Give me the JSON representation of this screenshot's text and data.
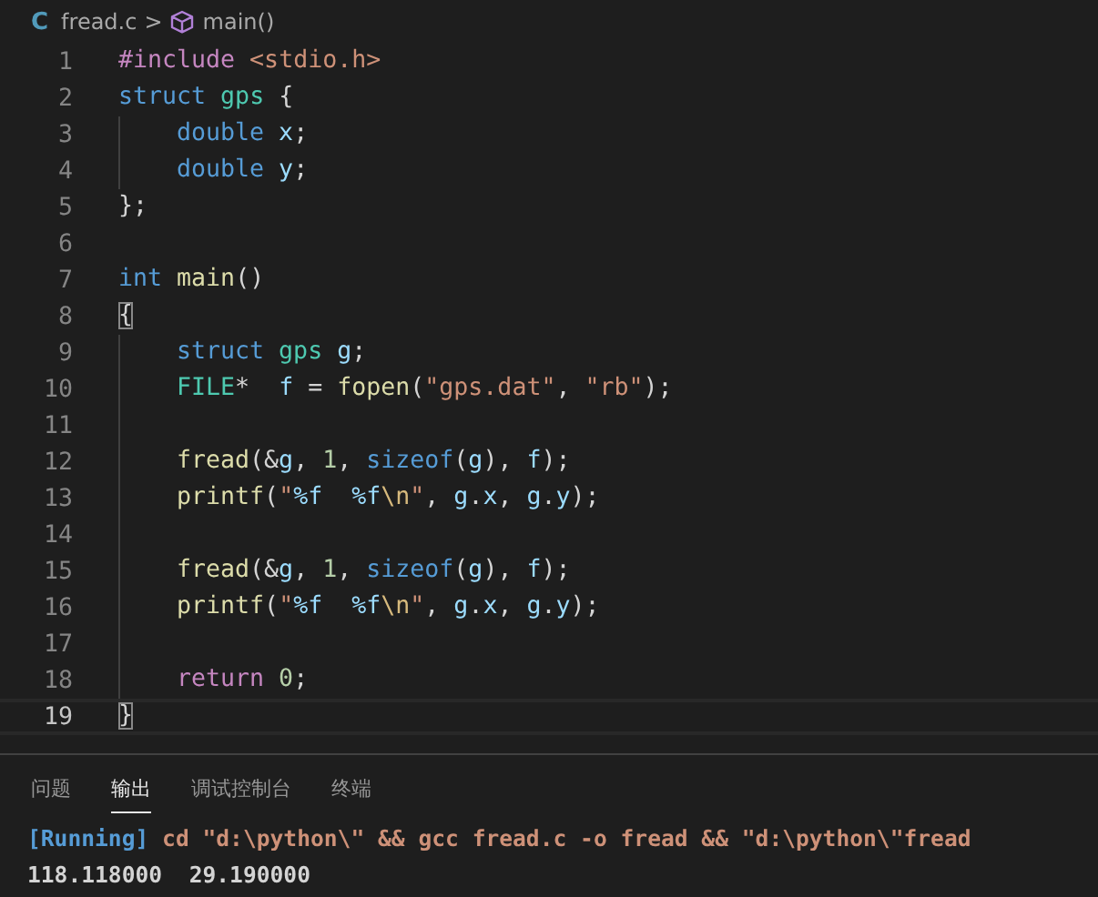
{
  "breadcrumb": {
    "lang_icon": "C",
    "file": "fread.c",
    "separator": ">",
    "symbol": "main()"
  },
  "lines": [
    {
      "number": "1",
      "current": false,
      "indent": false,
      "tokens": [
        {
          "kind": "control",
          "text": "#include"
        },
        {
          "kind": "string",
          "text": " <stdio.h>"
        }
      ]
    },
    {
      "number": "2",
      "current": false,
      "indent": false,
      "tokens": [
        {
          "kind": "keyword",
          "text": "struct"
        },
        {
          "kind": "type",
          "text": " gps"
        },
        {
          "kind": "plain",
          "text": " {"
        }
      ]
    },
    {
      "number": "3",
      "current": false,
      "indent": true,
      "tokens": [
        {
          "kind": "keyword",
          "text": "double"
        },
        {
          "kind": "var",
          "text": " x"
        },
        {
          "kind": "plain",
          "text": ";"
        }
      ]
    },
    {
      "number": "4",
      "current": false,
      "indent": true,
      "tokens": [
        {
          "kind": "keyword",
          "text": "double"
        },
        {
          "kind": "var",
          "text": " y"
        },
        {
          "kind": "plain",
          "text": ";"
        }
      ]
    },
    {
      "number": "5",
      "current": false,
      "indent": false,
      "tokens": [
        {
          "kind": "plain",
          "text": "};"
        }
      ]
    },
    {
      "number": "6",
      "current": false,
      "indent": false
    },
    {
      "number": "7",
      "current": false,
      "indent": false,
      "tokens": [
        {
          "kind": "keyword",
          "text": "int"
        },
        {
          "kind": "func",
          "text": " main"
        },
        {
          "kind": "plain",
          "text": "()"
        }
      ]
    },
    {
      "number": "8",
      "current": false,
      "indent": false,
      "tokens": [
        {
          "kind": "bracket",
          "text": "{"
        }
      ]
    },
    {
      "number": "9",
      "current": false,
      "indent": true,
      "tokens": [
        {
          "kind": "keyword",
          "text": "struct"
        },
        {
          "kind": "type",
          "text": " gps"
        },
        {
          "kind": "var",
          "text": " g"
        },
        {
          "kind": "plain",
          "text": ";"
        }
      ]
    },
    {
      "number": "10",
      "current": false,
      "indent": true,
      "tokens": [
        {
          "kind": "type",
          "text": "FILE"
        },
        {
          "kind": "plain",
          "text": "*  "
        },
        {
          "kind": "var",
          "text": "f"
        },
        {
          "kind": "plain",
          "text": " = "
        },
        {
          "kind": "func",
          "text": "fopen"
        },
        {
          "kind": "plain",
          "text": "("
        },
        {
          "kind": "string",
          "text": "\"gps.dat\""
        },
        {
          "kind": "plain",
          "text": ", "
        },
        {
          "kind": "string",
          "text": "\"rb\""
        },
        {
          "kind": "plain",
          "text": ");"
        }
      ]
    },
    {
      "number": "11",
      "current": false,
      "indent": true
    },
    {
      "number": "12",
      "current": false,
      "indent": true,
      "tokens": [
        {
          "kind": "func",
          "text": "fread"
        },
        {
          "kind": "plain",
          "text": "(&"
        },
        {
          "kind": "var",
          "text": "g"
        },
        {
          "kind": "plain",
          "text": ", "
        },
        {
          "kind": "number",
          "text": "1"
        },
        {
          "kind": "plain",
          "text": ", "
        },
        {
          "kind": "keyword",
          "text": "sizeof"
        },
        {
          "kind": "plain",
          "text": "("
        },
        {
          "kind": "var",
          "text": "g"
        },
        {
          "kind": "plain",
          "text": "), "
        },
        {
          "kind": "var",
          "text": "f"
        },
        {
          "kind": "plain",
          "text": ");"
        }
      ]
    },
    {
      "number": "13",
      "current": false,
      "indent": true,
      "tokens": [
        {
          "kind": "func",
          "text": "printf"
        },
        {
          "kind": "plain",
          "text": "("
        },
        {
          "kind": "string",
          "text": "\""
        },
        {
          "kind": "format",
          "text": "%f"
        },
        {
          "kind": "format",
          "text": "  %f"
        },
        {
          "kind": "escape",
          "text": "\\n"
        },
        {
          "kind": "string",
          "text": "\""
        },
        {
          "kind": "plain",
          "text": ", "
        },
        {
          "kind": "var",
          "text": "g"
        },
        {
          "kind": "plain",
          "text": "."
        },
        {
          "kind": "var",
          "text": "x"
        },
        {
          "kind": "plain",
          "text": ", "
        },
        {
          "kind": "var",
          "text": "g"
        },
        {
          "kind": "plain",
          "text": "."
        },
        {
          "kind": "var",
          "text": "y"
        },
        {
          "kind": "plain",
          "text": ");"
        }
      ]
    },
    {
      "number": "14",
      "current": false,
      "indent": true
    },
    {
      "number": "15",
      "current": false,
      "indent": true,
      "tokens": [
        {
          "kind": "func",
          "text": "fread"
        },
        {
          "kind": "plain",
          "text": "(&"
        },
        {
          "kind": "var",
          "text": "g"
        },
        {
          "kind": "plain",
          "text": ", "
        },
        {
          "kind": "number",
          "text": "1"
        },
        {
          "kind": "plain",
          "text": ", "
        },
        {
          "kind": "keyword",
          "text": "sizeof"
        },
        {
          "kind": "plain",
          "text": "("
        },
        {
          "kind": "var",
          "text": "g"
        },
        {
          "kind": "plain",
          "text": "), "
        },
        {
          "kind": "var",
          "text": "f"
        },
        {
          "kind": "plain",
          "text": ");"
        }
      ]
    },
    {
      "number": "16",
      "current": false,
      "indent": true,
      "tokens": [
        {
          "kind": "func",
          "text": "printf"
        },
        {
          "kind": "plain",
          "text": "("
        },
        {
          "kind": "string",
          "text": "\""
        },
        {
          "kind": "format",
          "text": "%f"
        },
        {
          "kind": "format",
          "text": "  %f"
        },
        {
          "kind": "escape",
          "text": "\\n"
        },
        {
          "kind": "string",
          "text": "\""
        },
        {
          "kind": "plain",
          "text": ", "
        },
        {
          "kind": "var",
          "text": "g"
        },
        {
          "kind": "plain",
          "text": "."
        },
        {
          "kind": "var",
          "text": "x"
        },
        {
          "kind": "plain",
          "text": ", "
        },
        {
          "kind": "var",
          "text": "g"
        },
        {
          "kind": "plain",
          "text": "."
        },
        {
          "kind": "var",
          "text": "y"
        },
        {
          "kind": "plain",
          "text": ");"
        }
      ]
    },
    {
      "number": "17",
      "current": false,
      "indent": true
    },
    {
      "number": "18",
      "current": false,
      "indent": true,
      "tokens": [
        {
          "kind": "control",
          "text": "return"
        },
        {
          "kind": "number",
          "text": " 0"
        },
        {
          "kind": "plain",
          "text": ";"
        }
      ]
    },
    {
      "number": "19",
      "current": true,
      "indent": false,
      "tokens": [
        {
          "kind": "bracket",
          "text": "}"
        }
      ]
    }
  ],
  "panel_tabs": [
    {
      "label": "问题",
      "selected": false
    },
    {
      "label": "输出",
      "selected": true
    },
    {
      "label": "调试控制台",
      "selected": false
    },
    {
      "label": "终端",
      "selected": false
    }
  ],
  "output": [
    {
      "tokens": [
        {
          "kind": "status",
          "text": "[Running]"
        },
        {
          "kind": "command",
          "text": " cd \"d:\\python\\\" && gcc fread.c -o fread && \"d:\\python\\\"fread"
        }
      ]
    },
    {
      "tokens": [
        {
          "kind": "result",
          "text": "118.118000  29.190000"
        }
      ]
    }
  ]
}
